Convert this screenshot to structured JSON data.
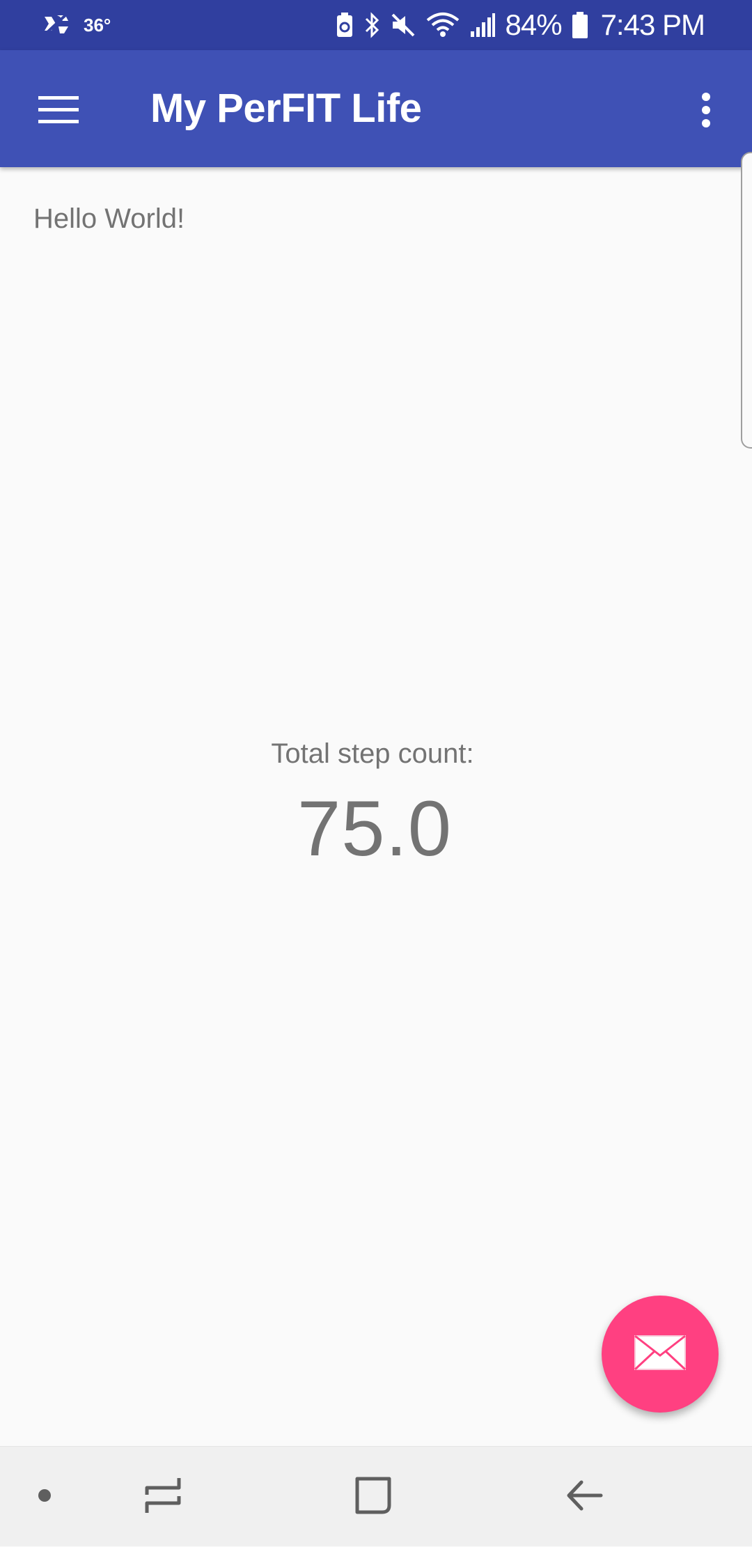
{
  "status_bar": {
    "temperature": "36°",
    "battery_percent": "84%",
    "time": "7:43 PM",
    "icons": [
      "notification-sync-icon",
      "battery-saver-icon",
      "bluetooth-icon",
      "mute-icon",
      "wifi-icon",
      "signal-icon",
      "battery-icon"
    ]
  },
  "app_bar": {
    "title": "My PerFIT Life",
    "menu_icon": "hamburger-menu-icon",
    "overflow_icon": "more-vert-icon",
    "color": "#3f51b5"
  },
  "content": {
    "greeting": "Hello World!",
    "step_label": "Total step count:",
    "step_value": "75.0"
  },
  "fab": {
    "icon": "mail-icon",
    "color": "#ff4081"
  },
  "nav_bar": {
    "icons": [
      "dot-icon",
      "recents-icon",
      "home-icon",
      "back-icon"
    ]
  }
}
